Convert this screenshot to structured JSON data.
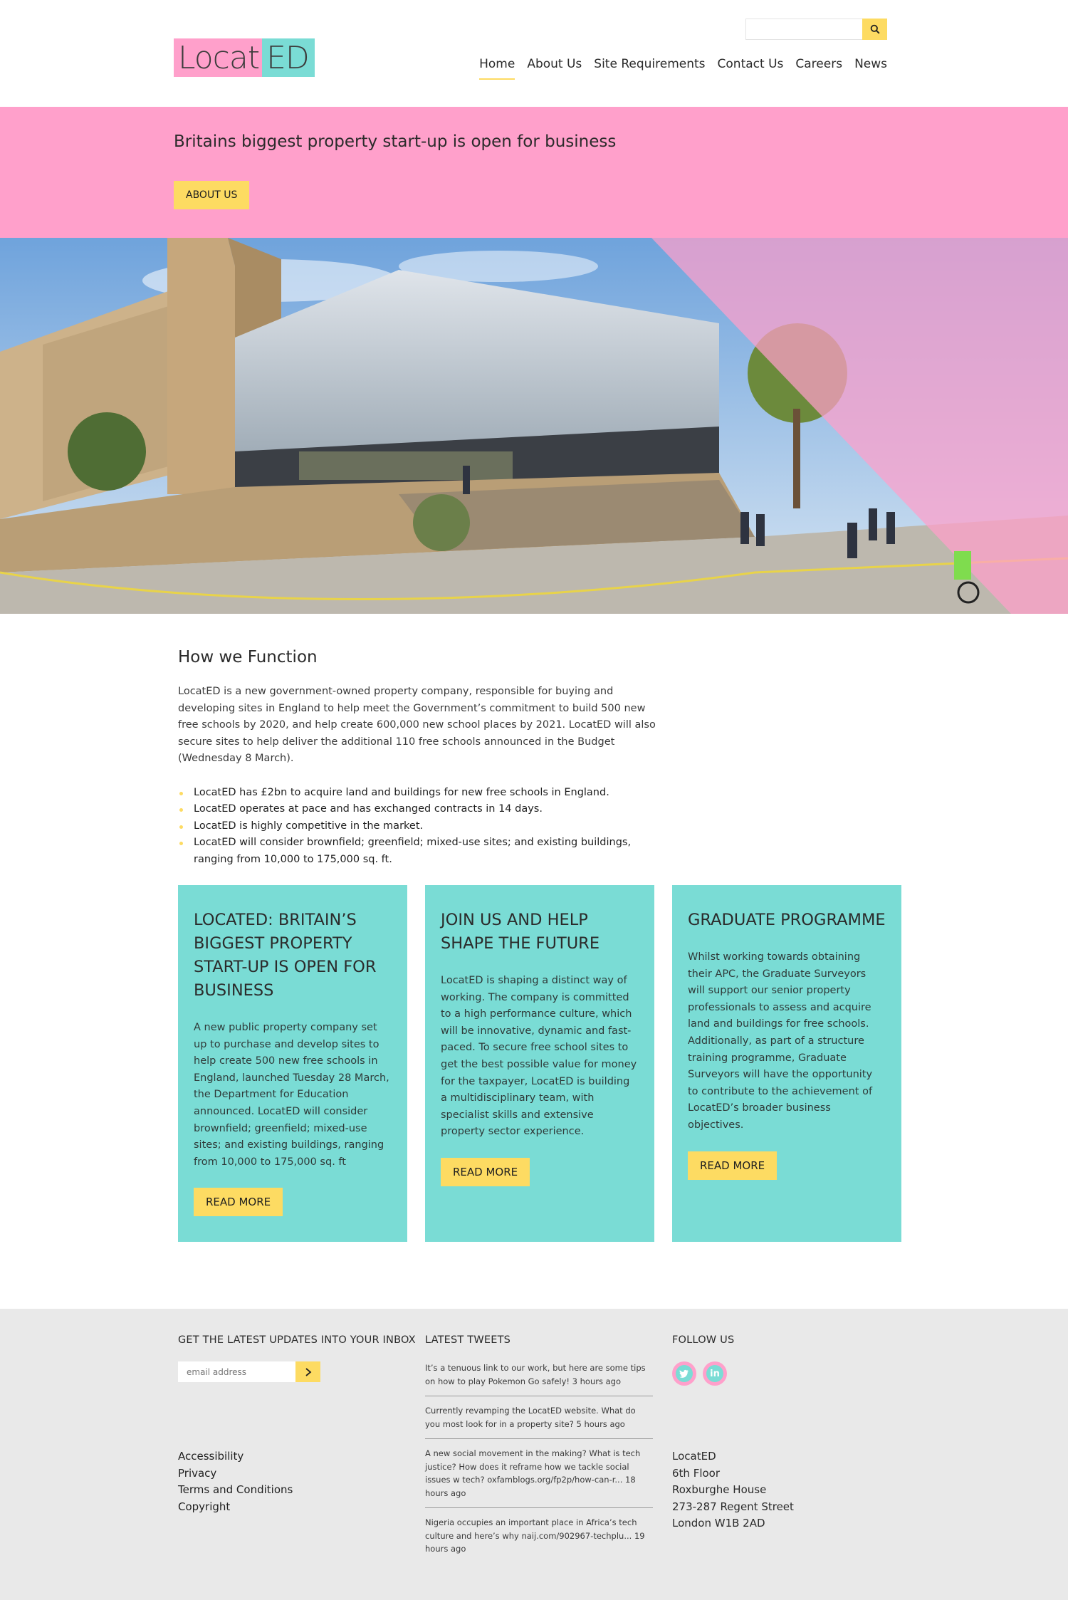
{
  "search": {
    "placeholder": ""
  },
  "logo": {
    "part1": "Locat",
    "part2": "ED"
  },
  "nav": [
    {
      "label": "Home",
      "active": true
    },
    {
      "label": "About Us"
    },
    {
      "label": "Site Requirements"
    },
    {
      "label": "Contact Us"
    },
    {
      "label": "Careers"
    },
    {
      "label": "News"
    }
  ],
  "hero": {
    "title": "Britains biggest property start-up is open for business",
    "button": "ABOUT US"
  },
  "intro": {
    "heading": "How we Function",
    "paragraph": "LocatED is a new government-owned property company, responsible for buying and developing sites in England to help meet the Government’s commitment to build 500 new free schools by 2020, and help create 600,000 new school places by 2021. LocatED will also secure sites to help deliver the additional 110 free schools announced in the Budget (Wednesday 8 March).",
    "bullets": [
      "LocatED has £2bn to acquire land and buildings for new free schools in England.",
      "LocatED operates at pace and has exchanged contracts in 14 days.",
      "LocatED is highly competitive in the market.",
      "LocatED will consider brownfield; greenfield; mixed-use sites; and existing buildings, ranging from 10,000 to 175,000 sq. ft."
    ]
  },
  "cards": [
    {
      "title": "LOCATED: BRITAIN’S BIGGEST PROPERTY START-UP IS OPEN FOR BUSINESS",
      "text": "A new public property company set up to purchase and develop sites to help create 500 new free schools in England, launched Tuesday 28 March, the Department for Education announced. LocatED will consider brownfield; greenfield; mixed-use sites; and existing buildings, ranging from 10,000 to 175,000 sq. ft",
      "button": "READ MORE"
    },
    {
      "title": "JOIN US AND HELP SHAPE THE FUTURE",
      "text": "LocatED is shaping a distinct way of working. The company is committed to a high performance culture, which will be innovative, dynamic and fast-paced. To secure free school sites to get the best possible value for money for the taxpayer, LocatED is building a multidisciplinary team, with specialist skills and extensive property sector experience.",
      "button": "READ MORE"
    },
    {
      "title": "GRADUATE PROGRAMME",
      "text": "Whilst working towards obtaining their APC, the Graduate Surveyors will support our senior property professionals to assess and acquire land and buildings for free schools. Additionally, as part of a structure training programme, Graduate Surveyors will have the opportunity to contribute to the achievement of LocatED’s broader business objectives.",
      "button": "READ MORE"
    }
  ],
  "footer": {
    "newsletter_heading": "GET THE LATEST UPDATES INTO YOUR INBOX",
    "email_placeholder": "email address",
    "tweets_heading": "LATEST TWEETS",
    "tweets": [
      "It’s a tenuous link to our work, but here are some tips on how to play Pokemon Go safely! 3 hours ago",
      "Currently revamping the LocatED website. What do you most look for in a property site? 5 hours ago",
      "A new social movement in the making? What is tech justice? How does it reframe how we tackle social issues w tech? oxfamblogs.org/fp2p/how-can-r... 18 hours ago",
      "Nigeria occupies an important place in Africa’s tech culture and here’s why naij.com/902967-techplu... 19 hours ago"
    ],
    "follow_heading": "FOLLOW US",
    "social": [
      {
        "name": "twitter",
        "glyph": "t"
      },
      {
        "name": "linkedin",
        "glyph": "in"
      }
    ],
    "links": [
      "Accessibility",
      "Privacy",
      "Terms and Conditions",
      "Copyright"
    ],
    "address": [
      "LocatED",
      "6th Floor",
      "Roxburghe House",
      "273-287 Regent Street",
      "London W1B 2AD"
    ]
  },
  "colors": {
    "pink": "#ffa0cb",
    "teal": "#7adcd5",
    "yellow": "#fddb62",
    "footer_bg": "#e9e9e9"
  }
}
